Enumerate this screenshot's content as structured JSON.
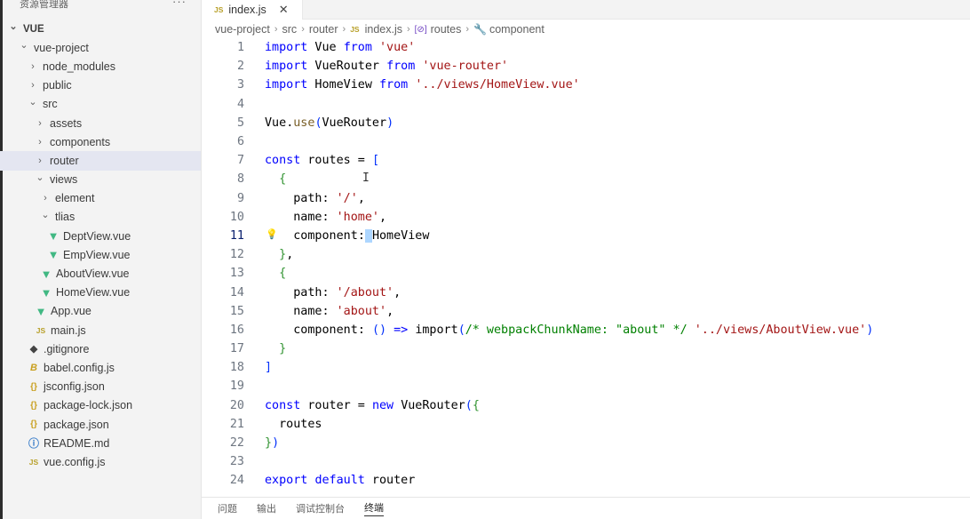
{
  "explorer": {
    "title": "资源管理器",
    "more": "···",
    "tree": [
      {
        "label": "VUE",
        "depth": 0,
        "kind": "root",
        "chevron": "down"
      },
      {
        "label": "vue-project",
        "depth": 1,
        "kind": "folder",
        "chevron": "down"
      },
      {
        "label": "node_modules",
        "depth": 2,
        "kind": "folder",
        "chevron": "right"
      },
      {
        "label": "public",
        "depth": 2,
        "kind": "folder",
        "chevron": "right"
      },
      {
        "label": "src",
        "depth": 2,
        "kind": "folder",
        "chevron": "down"
      },
      {
        "label": "assets",
        "depth": 3,
        "kind": "folder",
        "chevron": "right"
      },
      {
        "label": "components",
        "depth": 3,
        "kind": "folder",
        "chevron": "right"
      },
      {
        "label": "router",
        "depth": 3,
        "kind": "folder",
        "chevron": "right",
        "selected": true
      },
      {
        "label": "views",
        "depth": 3,
        "kind": "folder",
        "chevron": "down"
      },
      {
        "label": "element",
        "depth": 4,
        "kind": "folder",
        "chevron": "right"
      },
      {
        "label": "tlias",
        "depth": 4,
        "kind": "folder",
        "chevron": "down"
      },
      {
        "label": "DeptView.vue",
        "depth": 5,
        "kind": "vue"
      },
      {
        "label": "EmpView.vue",
        "depth": 5,
        "kind": "vue"
      },
      {
        "label": "AboutView.vue",
        "depth": 4,
        "kind": "vue"
      },
      {
        "label": "HomeView.vue",
        "depth": 4,
        "kind": "vue"
      },
      {
        "label": "App.vue",
        "depth": 3,
        "kind": "vue"
      },
      {
        "label": "main.js",
        "depth": 3,
        "kind": "js"
      },
      {
        "label": ".gitignore",
        "depth": 2,
        "kind": "git"
      },
      {
        "label": "babel.config.js",
        "depth": 2,
        "kind": "babel"
      },
      {
        "label": "jsconfig.json",
        "depth": 2,
        "kind": "json"
      },
      {
        "label": "package-lock.json",
        "depth": 2,
        "kind": "json"
      },
      {
        "label": "package.json",
        "depth": 2,
        "kind": "json"
      },
      {
        "label": "README.md",
        "depth": 2,
        "kind": "info"
      },
      {
        "label": "vue.config.js",
        "depth": 2,
        "kind": "js"
      }
    ]
  },
  "icons": {
    "vue": "▼",
    "js": "JS",
    "git": "◆",
    "babel": "B",
    "json": "{}",
    "info": "ⓘ",
    "chev_down": "⌄",
    "chev_right": "›"
  },
  "tab": {
    "label": "index.js",
    "icon": "JS",
    "close": "✕"
  },
  "breadcrumb": {
    "items": [
      {
        "label": "vue-project",
        "icon": ""
      },
      {
        "label": "src",
        "icon": ""
      },
      {
        "label": "router",
        "icon": ""
      },
      {
        "label": "index.js",
        "icon": "JS"
      },
      {
        "label": "routes",
        "icon": "[⊘]"
      },
      {
        "label": "component",
        "icon": "🔧"
      }
    ],
    "separator": "›"
  },
  "editor": {
    "active_line": 11,
    "lines": [
      [
        {
          "t": "import",
          "c": "kw"
        },
        {
          "t": " Vue ",
          "c": "plain"
        },
        {
          "t": "from",
          "c": "kw"
        },
        {
          "t": " ",
          "c": "plain"
        },
        {
          "t": "'vue'",
          "c": "str"
        }
      ],
      [
        {
          "t": "import",
          "c": "kw"
        },
        {
          "t": " VueRouter ",
          "c": "plain"
        },
        {
          "t": "from",
          "c": "kw"
        },
        {
          "t": " ",
          "c": "plain"
        },
        {
          "t": "'vue-router'",
          "c": "str"
        }
      ],
      [
        {
          "t": "import",
          "c": "kw"
        },
        {
          "t": " HomeView ",
          "c": "plain"
        },
        {
          "t": "from",
          "c": "kw"
        },
        {
          "t": " ",
          "c": "plain"
        },
        {
          "t": "'../views/HomeView.vue'",
          "c": "str"
        }
      ],
      [],
      [
        {
          "t": "Vue",
          "c": "plain"
        },
        {
          "t": ".",
          "c": "plain"
        },
        {
          "t": "use",
          "c": "fn"
        },
        {
          "t": "(",
          "c": "br"
        },
        {
          "t": "VueRouter",
          "c": "plain"
        },
        {
          "t": ")",
          "c": "br"
        }
      ],
      [],
      [
        {
          "t": "const",
          "c": "kw"
        },
        {
          "t": " routes = ",
          "c": "plain"
        },
        {
          "t": "[",
          "c": "br"
        }
      ],
      [
        {
          "t": "  ",
          "c": "plain"
        },
        {
          "t": "{",
          "c": "br2"
        }
      ],
      [
        {
          "t": "    ",
          "c": "plain"
        },
        {
          "t": "path",
          "c": "plain"
        },
        {
          "t": ": ",
          "c": "plain"
        },
        {
          "t": "'/'",
          "c": "str"
        },
        {
          "t": ",",
          "c": "plain"
        }
      ],
      [
        {
          "t": "    ",
          "c": "plain"
        },
        {
          "t": "name",
          "c": "plain"
        },
        {
          "t": ": ",
          "c": "plain"
        },
        {
          "t": "'home'",
          "c": "str"
        },
        {
          "t": ",",
          "c": "plain"
        }
      ],
      [
        {
          "t": "    ",
          "c": "plain"
        },
        {
          "t": "component",
          "c": "plain"
        },
        {
          "t": ":",
          "c": "plain"
        },
        {
          "t": " ",
          "c": "cursor"
        },
        {
          "t": "HomeView",
          "c": "plain"
        }
      ],
      [
        {
          "t": "  ",
          "c": "plain"
        },
        {
          "t": "}",
          "c": "br2"
        },
        {
          "t": ",",
          "c": "plain"
        }
      ],
      [
        {
          "t": "  ",
          "c": "plain"
        },
        {
          "t": "{",
          "c": "br2"
        }
      ],
      [
        {
          "t": "    ",
          "c": "plain"
        },
        {
          "t": "path",
          "c": "plain"
        },
        {
          "t": ": ",
          "c": "plain"
        },
        {
          "t": "'/about'",
          "c": "str"
        },
        {
          "t": ",",
          "c": "plain"
        }
      ],
      [
        {
          "t": "    ",
          "c": "plain"
        },
        {
          "t": "name",
          "c": "plain"
        },
        {
          "t": ": ",
          "c": "plain"
        },
        {
          "t": "'about'",
          "c": "str"
        },
        {
          "t": ",",
          "c": "plain"
        }
      ],
      [
        {
          "t": "    ",
          "c": "plain"
        },
        {
          "t": "component",
          "c": "plain"
        },
        {
          "t": ": ",
          "c": "plain"
        },
        {
          "t": "()",
          "c": "br"
        },
        {
          "t": " ",
          "c": "plain"
        },
        {
          "t": "=>",
          "c": "kw"
        },
        {
          "t": " ",
          "c": "plain"
        },
        {
          "t": "import",
          "c": "plain"
        },
        {
          "t": "(",
          "c": "br"
        },
        {
          "t": "/* webpackChunkName: \"about\" */",
          "c": "cm"
        },
        {
          "t": " ",
          "c": "plain"
        },
        {
          "t": "'../views/AboutView.vue'",
          "c": "str"
        },
        {
          "t": ")",
          "c": "br"
        }
      ],
      [
        {
          "t": "  ",
          "c": "plain"
        },
        {
          "t": "}",
          "c": "br2"
        }
      ],
      [
        {
          "t": "]",
          "c": "br"
        }
      ],
      [],
      [
        {
          "t": "const",
          "c": "kw"
        },
        {
          "t": " router = ",
          "c": "plain"
        },
        {
          "t": "new",
          "c": "kw"
        },
        {
          "t": " ",
          "c": "plain"
        },
        {
          "t": "VueRouter",
          "c": "plain"
        },
        {
          "t": "(",
          "c": "br"
        },
        {
          "t": "{",
          "c": "br2"
        }
      ],
      [
        {
          "t": "  routes",
          "c": "plain"
        }
      ],
      [
        {
          "t": "}",
          "c": "br2"
        },
        {
          "t": ")",
          "c": "br"
        }
      ],
      [],
      [
        {
          "t": "export",
          "c": "kw"
        },
        {
          "t": " ",
          "c": "plain"
        },
        {
          "t": "default",
          "c": "kw"
        },
        {
          "t": " router",
          "c": "plain"
        }
      ]
    ]
  },
  "panel": {
    "tabs": [
      {
        "label": "问题"
      },
      {
        "label": "输出"
      },
      {
        "label": "调试控制台"
      },
      {
        "label": "终端",
        "active": true
      }
    ]
  }
}
